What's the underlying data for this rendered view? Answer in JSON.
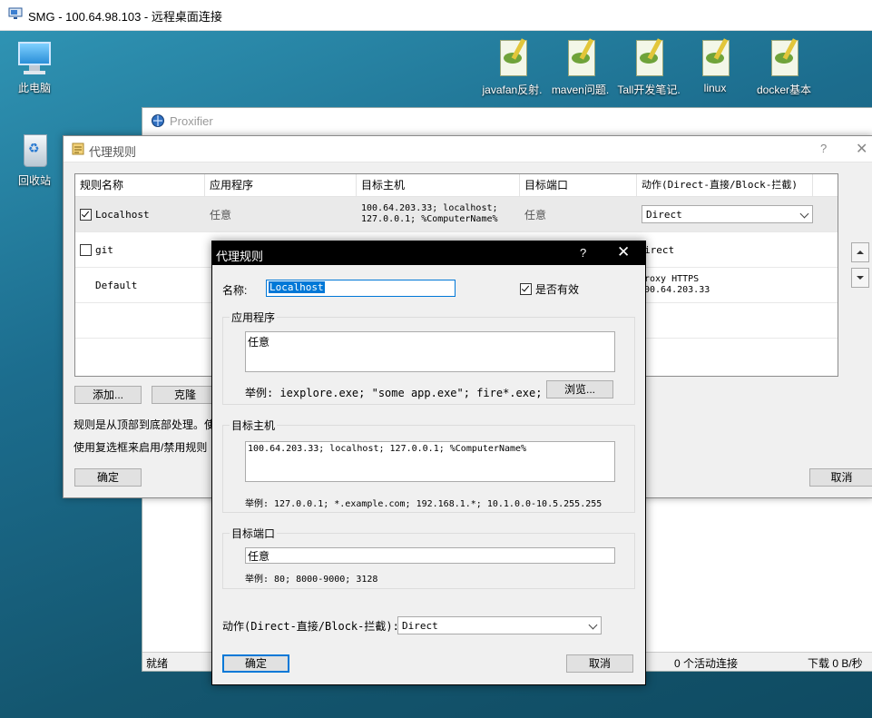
{
  "rdp": {
    "title": "SMG - 100.64.98.103 - 远程桌面连接"
  },
  "desktop": {
    "icons": [
      {
        "label": "此电脑"
      },
      {
        "label": "回收站"
      }
    ],
    "files": [
      {
        "label": "javafan反射."
      },
      {
        "label": "maven问题."
      },
      {
        "label": "Tall开发笔记."
      },
      {
        "label": "linux"
      },
      {
        "label": "docker基本"
      }
    ]
  },
  "proxifier": {
    "title": "Proxifier",
    "status": {
      "ready": "就绪",
      "connections": "0 个活动连接",
      "download": "下载 0 B/秒"
    }
  },
  "rules_dialog": {
    "title": "代理规则",
    "help": "?",
    "close": "✕",
    "columns": [
      "规则名称",
      "应用程序",
      "目标主机",
      "目标端口",
      "动作(Direct-直接/Block-拦截)"
    ],
    "rows": [
      {
        "name": "Localhost",
        "checked": true,
        "app": "任意",
        "host_line1": "100.64.203.33; localhost;",
        "host_line2": "127.0.0.1; %ComputerName%",
        "port": "任意",
        "action": "Direct"
      },
      {
        "name": "git",
        "checked": false,
        "action": "irect"
      },
      {
        "name": "Default",
        "action_line1": "roxy HTTPS",
        "action_line2": "00.64.203.33"
      }
    ],
    "buttons": {
      "add": "添加...",
      "clone": "克隆",
      "ok": "确定",
      "cancel": "取消"
    },
    "info1": "规则是从顶部到底部处理。使",
    "info2": "使用复选框来启用/禁用规则"
  },
  "edit_dialog": {
    "title": "代理规则",
    "help": "?",
    "close": "✕",
    "name_label": "名称:",
    "name_value": "Localhost",
    "enabled_label": "是否有效",
    "enabled": true,
    "app_group": "应用程序",
    "app_value": "任意",
    "app_example": "举例: iexplore.exe; \"some app.exe\"; fire*.exe; *.bin",
    "browse": "浏览...",
    "host_group": "目标主机",
    "host_value": "100.64.203.33; localhost; 127.0.0.1; %ComputerName%",
    "host_example": "举例: 127.0.0.1; *.example.com; 192.168.1.*; 10.1.0.0-10.5.255.255",
    "port_group": "目标端口",
    "port_value": "任意",
    "port_example": "举例: 80; 8000-9000; 3128",
    "action_label": "动作(Direct-直接/Block-拦截):",
    "action_value": "Direct",
    "ok": "确定",
    "cancel": "取消"
  }
}
